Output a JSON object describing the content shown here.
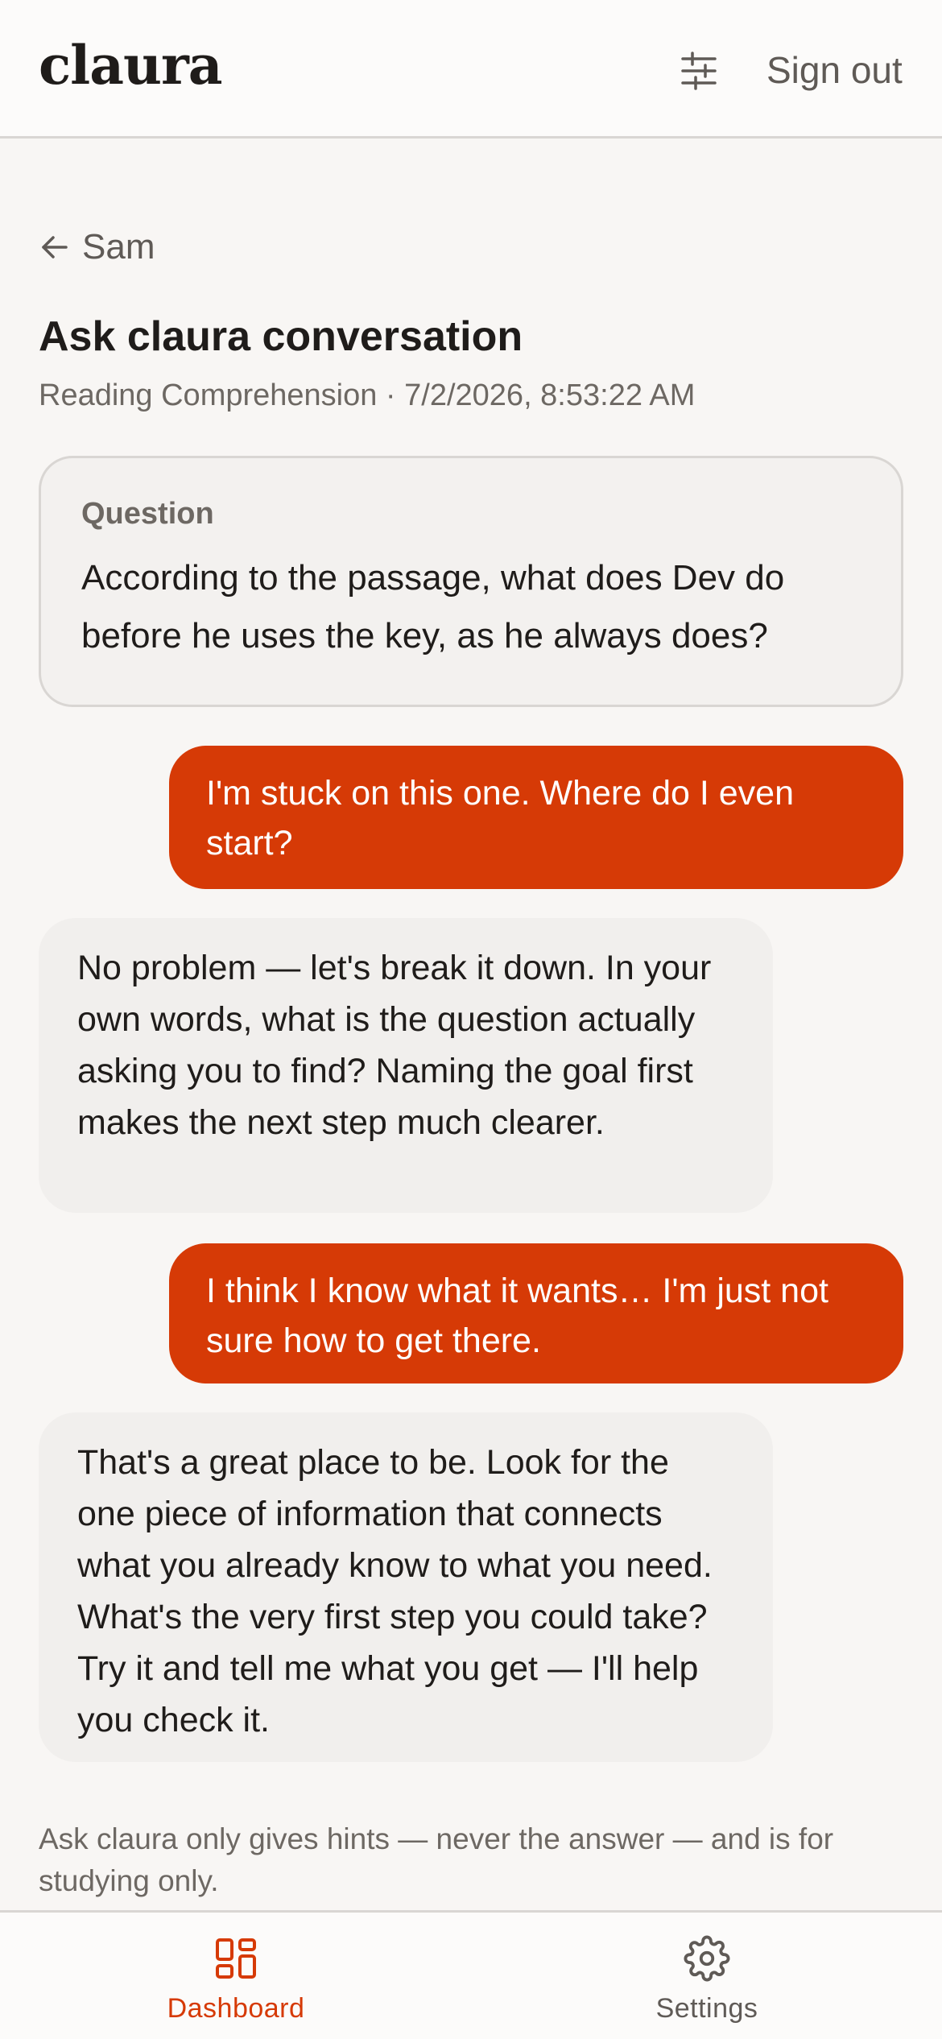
{
  "header": {
    "logo": "claura",
    "filters_icon": "sliders-icon",
    "sign_out_label": "Sign out"
  },
  "back": {
    "icon": "arrow-left-icon",
    "label": "Sam"
  },
  "page": {
    "title": "Ask claura conversation",
    "subtitle": "Reading Comprehension · 7/2/2026, 8:53:22 AM"
  },
  "question": {
    "label": "Question",
    "text": "According to the passage, what does Dev do before he uses the key, as he always does?"
  },
  "messages": [
    {
      "role": "user",
      "text": "I'm stuck on this one. Where do I even start?"
    },
    {
      "role": "assistant",
      "text": "No problem — let's break it down. In your own words, what is the question actually asking you to find? Naming the goal first makes the next step much clearer."
    },
    {
      "role": "user",
      "text": "I think I know what it wants… I'm just not sure how to get there."
    },
    {
      "role": "assistant",
      "text": "That's a great place to be. Look for the one piece of information that connects what you already know to what you need. What's the very first step you could take? Try it and tell me what you get — I'll help you check it."
    }
  ],
  "disclaimer": "Ask claura only gives hints — never the answer — and is for studying only.",
  "nav": {
    "items": [
      {
        "label": "Dashboard",
        "icon": "dashboard-icon",
        "active": true
      },
      {
        "label": "Settings",
        "icon": "gear-icon",
        "active": false
      }
    ]
  },
  "colors": {
    "accent": "#d63a06",
    "background": "#f8f6f4",
    "bubble_assistant": "#f1efed"
  }
}
